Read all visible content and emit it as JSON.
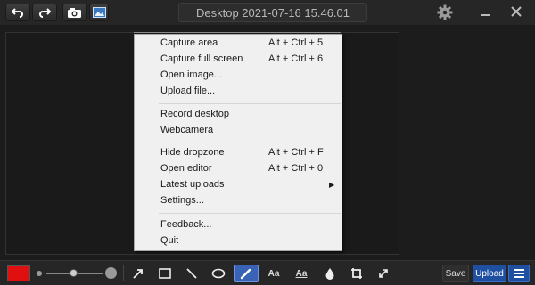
{
  "titlebar": {
    "title": "Desktop 2021-07-16 15.46.01",
    "icons": [
      "undo-icon",
      "redo-icon",
      "camera-icon",
      "image-icon",
      "gear-icon",
      "minimize-icon",
      "close-icon"
    ]
  },
  "menu": {
    "items": [
      {
        "label": "Capture area",
        "shortcut": "Alt + Ctrl + 5"
      },
      {
        "label": "Capture full screen",
        "shortcut": "Alt + Ctrl + 6"
      },
      {
        "label": "Open image...",
        "shortcut": ""
      },
      {
        "label": "Upload file...",
        "shortcut": ""
      },
      {
        "label": "Record desktop",
        "shortcut": ""
      },
      {
        "label": "Webcamera",
        "shortcut": ""
      },
      {
        "label": "Hide dropzone",
        "shortcut": "Alt + Ctrl + F"
      },
      {
        "label": "Open editor",
        "shortcut": "Alt + Ctrl + 0"
      },
      {
        "label": "Latest uploads",
        "shortcut": "",
        "submenu": true
      },
      {
        "label": "Settings...",
        "shortcut": ""
      },
      {
        "label": "Feedback...",
        "shortcut": ""
      },
      {
        "label": "Quit",
        "shortcut": ""
      }
    ]
  },
  "toolbar": {
    "color": "#e01010",
    "tools": [
      "arrow-icon",
      "rectangle-icon",
      "line-icon",
      "ellipse-icon",
      "pen-icon",
      "text-icon",
      "text-shadow-icon",
      "blur-drop-icon",
      "crop-icon",
      "resize-icon"
    ],
    "active_tool": "pen-icon",
    "text_label": "Aa",
    "text_label_2": "Aa",
    "save_label": "Save",
    "upload_label": "Upload"
  },
  "colors": {
    "accent": "#1f4fa0",
    "background": "#1c1c1c",
    "menu_bg": "#f0f0f0"
  }
}
